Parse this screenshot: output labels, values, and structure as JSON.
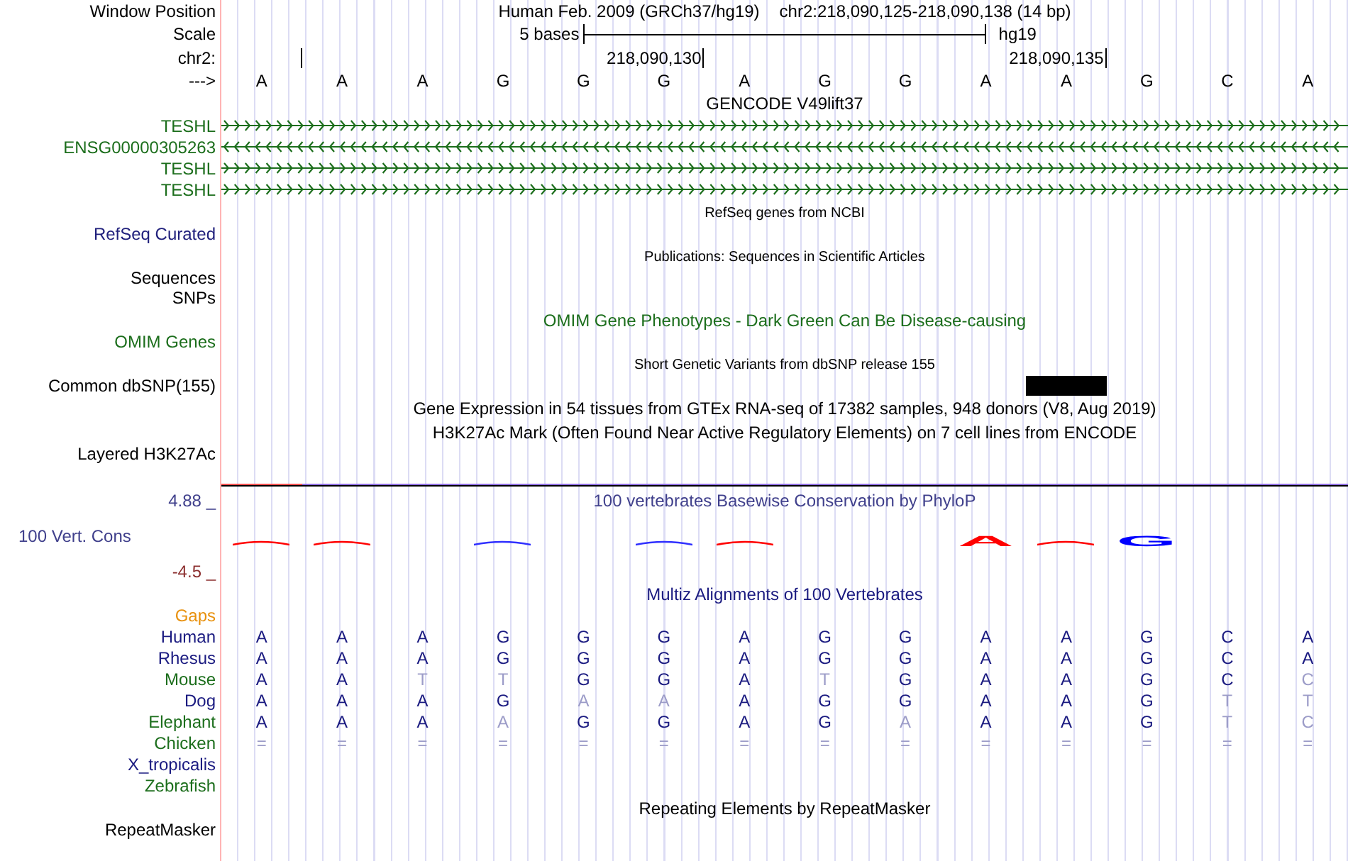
{
  "position": {
    "label": "Window Position",
    "assembly": "Human Feb. 2009 (GRCh37/hg19)",
    "range": "chr2:218,090,125-218,090,138 (14 bp)"
  },
  "scale": {
    "label": "Scale",
    "bar_label": "5 bases",
    "assembly": "hg19"
  },
  "ruler": {
    "label": "chr2:",
    "ticks": [
      "218,090,130",
      "218,090,135"
    ]
  },
  "sequence": {
    "label": "--->",
    "bases": [
      "A",
      "A",
      "A",
      "G",
      "G",
      "G",
      "A",
      "G",
      "G",
      "A",
      "A",
      "G",
      "C",
      "A"
    ]
  },
  "tracks": [
    {
      "kind": "genes",
      "title": "GENCODE V49lift37",
      "dense": false,
      "color": "#000000",
      "rows": [
        {
          "label": "TESHL",
          "reverse": false,
          "color": "#1c6e1c"
        },
        {
          "label": "ENSG00000305263",
          "reverse": true,
          "color": "#1c6e1c"
        },
        {
          "label": "TESHL",
          "reverse": false,
          "color": "#1c6e1c"
        },
        {
          "label": "TESHL",
          "reverse": false,
          "color": "#1c6e1c"
        }
      ]
    },
    {
      "kind": "simple",
      "title": "RefSeq genes from NCBI",
      "dense": true,
      "color": "#000000",
      "labels": [
        {
          "text": "RefSeq Curated",
          "color": "#20207c"
        }
      ]
    },
    {
      "kind": "simple",
      "title": "Publications: Sequences in Scientific Articles",
      "dense": true,
      "color": "#000000",
      "labels": [
        {
          "text": "Sequences",
          "color": "#000000"
        },
        {
          "text": "SNPs",
          "color": "#000000"
        }
      ]
    },
    {
      "kind": "simple",
      "title": "OMIM Gene Phenotypes - Dark Green Can Be Disease-causing",
      "dense": false,
      "color": "#1c6e1c",
      "labels": [
        {
          "text": "OMIM Genes",
          "color": "#1c6e1c"
        }
      ]
    },
    {
      "kind": "variants",
      "title": "Short Genetic Variants from dbSNP release 155",
      "dense": true,
      "color": "#000000",
      "label": "Common dbSNP(155)",
      "columns": [
        {
          "variant": false
        },
        {
          "variant": false
        },
        {
          "variant": false
        },
        {
          "variant": false
        },
        {
          "variant": false
        },
        {
          "variant": false
        },
        {
          "variant": false
        },
        {
          "variant": false
        },
        {
          "variant": false
        },
        {
          "variant": false
        },
        {
          "variant": true
        },
        {
          "variant": false
        },
        {
          "variant": false
        },
        {
          "variant": false
        }
      ]
    },
    {
      "kind": "simple",
      "title": "Gene Expression in 54 tissues from GTEx RNA-seq of 17382 samples, 948 donors (V8, Aug 2019)",
      "dense": false,
      "color": "#000000"
    },
    {
      "kind": "simple",
      "title": "H3K27Ac Mark (Often Found Near Active Regulatory Elements) on 7 cell lines from ENCODE",
      "dense": false,
      "color": "#000000",
      "labels": [
        {
          "text": "Layered H3K27Ac",
          "color": "#000000"
        }
      ]
    },
    {
      "kind": "conservation",
      "title": "100 vertebrates Basewise Conservation by PhyloP",
      "dense": false,
      "color": "#40408c",
      "label": "100 Vert. Cons",
      "ymax": "4.88 _",
      "ymin": "-4.5 _",
      "logo": [
        {
          "kind": "flat",
          "color": "#ff0000"
        },
        {
          "kind": "flat",
          "color": "#ff0000"
        },
        {
          "kind": "none"
        },
        {
          "kind": "flat",
          "color": "#3030ff"
        },
        {
          "kind": "none"
        },
        {
          "kind": "flat",
          "color": "#3030ff"
        },
        {
          "kind": "flat",
          "color": "#ff0000"
        },
        {
          "kind": "none"
        },
        {
          "kind": "none"
        },
        {
          "kind": "letter",
          "letter": "A",
          "color": "#ff0000"
        },
        {
          "kind": "flat",
          "color": "#ff0000"
        },
        {
          "kind": "letter",
          "letter": "G",
          "color": "#0000ff"
        },
        {
          "kind": "none"
        },
        {
          "kind": "none"
        }
      ]
    },
    {
      "kind": "alignment",
      "title": "Multiz Alignments of 100 Vertebrates",
      "dense": false,
      "color": "#1a1a80",
      "gaps_label": "Gaps",
      "species": [
        {
          "name": "Human",
          "color": "#1a1a80",
          "cells": [
            {
              "base": "A",
              "faded": false
            },
            {
              "base": "A",
              "faded": false
            },
            {
              "base": "A",
              "faded": false
            },
            {
              "base": "G",
              "faded": false
            },
            {
              "base": "G",
              "faded": false
            },
            {
              "base": "G",
              "faded": false
            },
            {
              "base": "A",
              "faded": false
            },
            {
              "base": "G",
              "faded": false
            },
            {
              "base": "G",
              "faded": false
            },
            {
              "base": "A",
              "faded": false
            },
            {
              "base": "A",
              "faded": false
            },
            {
              "base": "G",
              "faded": false
            },
            {
              "base": "C",
              "faded": false
            },
            {
              "base": "A",
              "faded": false
            }
          ]
        },
        {
          "name": "Rhesus",
          "color": "#1a1a80",
          "cells": [
            {
              "base": "A",
              "faded": false
            },
            {
              "base": "A",
              "faded": false
            },
            {
              "base": "A",
              "faded": false
            },
            {
              "base": "G",
              "faded": false
            },
            {
              "base": "G",
              "faded": false
            },
            {
              "base": "G",
              "faded": false
            },
            {
              "base": "A",
              "faded": false
            },
            {
              "base": "G",
              "faded": false
            },
            {
              "base": "G",
              "faded": false
            },
            {
              "base": "A",
              "faded": false
            },
            {
              "base": "A",
              "faded": false
            },
            {
              "base": "G",
              "faded": false
            },
            {
              "base": "C",
              "faded": false
            },
            {
              "base": "A",
              "faded": false
            }
          ]
        },
        {
          "name": "Mouse",
          "color": "#1c6e1c",
          "cells": [
            {
              "base": "A",
              "faded": false
            },
            {
              "base": "A",
              "faded": false
            },
            {
              "base": "T",
              "faded": true
            },
            {
              "base": "T",
              "faded": true
            },
            {
              "base": "G",
              "faded": false
            },
            {
              "base": "G",
              "faded": false
            },
            {
              "base": "A",
              "faded": false
            },
            {
              "base": "T",
              "faded": true
            },
            {
              "base": "G",
              "faded": false
            },
            {
              "base": "A",
              "faded": false
            },
            {
              "base": "A",
              "faded": false
            },
            {
              "base": "G",
              "faded": false
            },
            {
              "base": "C",
              "faded": false
            },
            {
              "base": "C",
              "faded": true
            }
          ]
        },
        {
          "name": "Dog",
          "color": "#1a1a80",
          "cells": [
            {
              "base": "A",
              "faded": false
            },
            {
              "base": "A",
              "faded": false
            },
            {
              "base": "A",
              "faded": false
            },
            {
              "base": "G",
              "faded": false
            },
            {
              "base": "A",
              "faded": true
            },
            {
              "base": "A",
              "faded": true
            },
            {
              "base": "A",
              "faded": false
            },
            {
              "base": "G",
              "faded": false
            },
            {
              "base": "G",
              "faded": false
            },
            {
              "base": "A",
              "faded": false
            },
            {
              "base": "A",
              "faded": false
            },
            {
              "base": "G",
              "faded": false
            },
            {
              "base": "T",
              "faded": true
            },
            {
              "base": "T",
              "faded": true
            }
          ]
        },
        {
          "name": "Elephant",
          "color": "#1c6e1c",
          "cells": [
            {
              "base": "A",
              "faded": false
            },
            {
              "base": "A",
              "faded": false
            },
            {
              "base": "A",
              "faded": false
            },
            {
              "base": "A",
              "faded": true
            },
            {
              "base": "G",
              "faded": false
            },
            {
              "base": "G",
              "faded": false
            },
            {
              "base": "A",
              "faded": false
            },
            {
              "base": "G",
              "faded": false
            },
            {
              "base": "A",
              "faded": true
            },
            {
              "base": "A",
              "faded": false
            },
            {
              "base": "A",
              "faded": false
            },
            {
              "base": "G",
              "faded": false
            },
            {
              "base": "T",
              "faded": true
            },
            {
              "base": "C",
              "faded": true
            }
          ]
        },
        {
          "name": "Chicken",
          "color": "#1c6e1c",
          "cells": [
            {
              "base": "=",
              "faded": true
            },
            {
              "base": "=",
              "faded": true
            },
            {
              "base": "=",
              "faded": true
            },
            {
              "base": "=",
              "faded": true
            },
            {
              "base": "=",
              "faded": true
            },
            {
              "base": "=",
              "faded": true
            },
            {
              "base": "=",
              "faded": true
            },
            {
              "base": "=",
              "faded": true
            },
            {
              "base": "=",
              "faded": true
            },
            {
              "base": "=",
              "faded": true
            },
            {
              "base": "=",
              "faded": true
            },
            {
              "base": "=",
              "faded": true
            },
            {
              "base": "=",
              "faded": true
            },
            {
              "base": "=",
              "faded": true
            }
          ]
        },
        {
          "name": "X_tropicalis",
          "color": "#1a1a80"
        },
        {
          "name": "Zebrafish",
          "color": "#1c6e1c"
        }
      ]
    },
    {
      "kind": "simple",
      "title": "Repeating Elements by RepeatMasker",
      "dense": false,
      "color": "#000000",
      "labels": [
        {
          "text": "RepeatMasker",
          "color": "#000000"
        }
      ]
    }
  ]
}
